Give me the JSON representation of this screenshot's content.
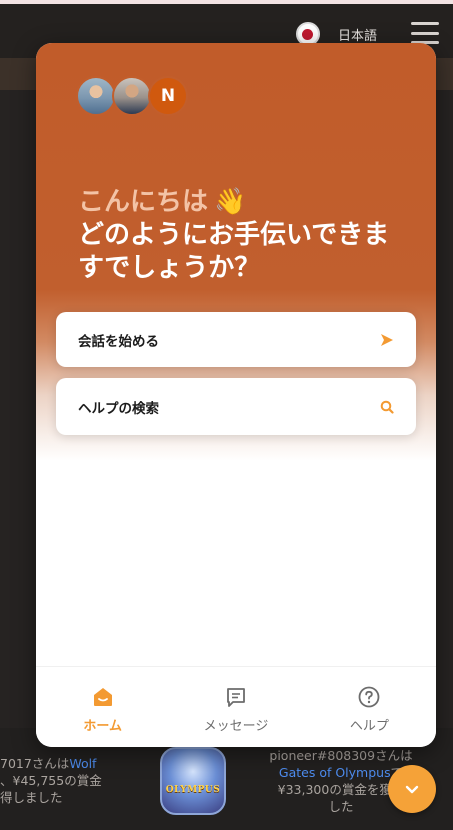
{
  "header": {
    "language_label": "日本語",
    "flag_icon": "japan-flag-icon",
    "menu_icon": "hamburger-menu-icon"
  },
  "messenger": {
    "avatar_initial": "N",
    "greeting_hello": "こんにちは",
    "greeting_wave": "👋",
    "greeting_question": "どのようにお手伝いできますでしょうか？",
    "start_conversation_label": "会話を始める",
    "start_conversation_icon": "send-arrow-icon",
    "help_search_label": "ヘルプの検索",
    "help_search_icon": "search-icon",
    "nav": [
      {
        "label": "ホーム",
        "icon": "home-icon",
        "active": true
      },
      {
        "label": "メッセージ",
        "icon": "message-icon",
        "active": false
      },
      {
        "label": "ヘルプ",
        "icon": "help-icon",
        "active": false
      }
    ]
  },
  "ticker": {
    "left": {
      "line1_prefix": "7017さんは",
      "line1_game": "Wolf",
      "line2": "、¥45,755の賞金",
      "line3": "得しました"
    },
    "game_badge_text": "OLYMPUS",
    "right": {
      "line1": "pioneer#808309さんは",
      "game": "Gates of Olympus",
      "game_suffix": "で",
      "line3": "¥33,300の賞金を獲得",
      "line4": "した"
    }
  },
  "colors": {
    "accent": "#f39a32",
    "hero": "#c15c2a",
    "link": "#4e8df0"
  }
}
